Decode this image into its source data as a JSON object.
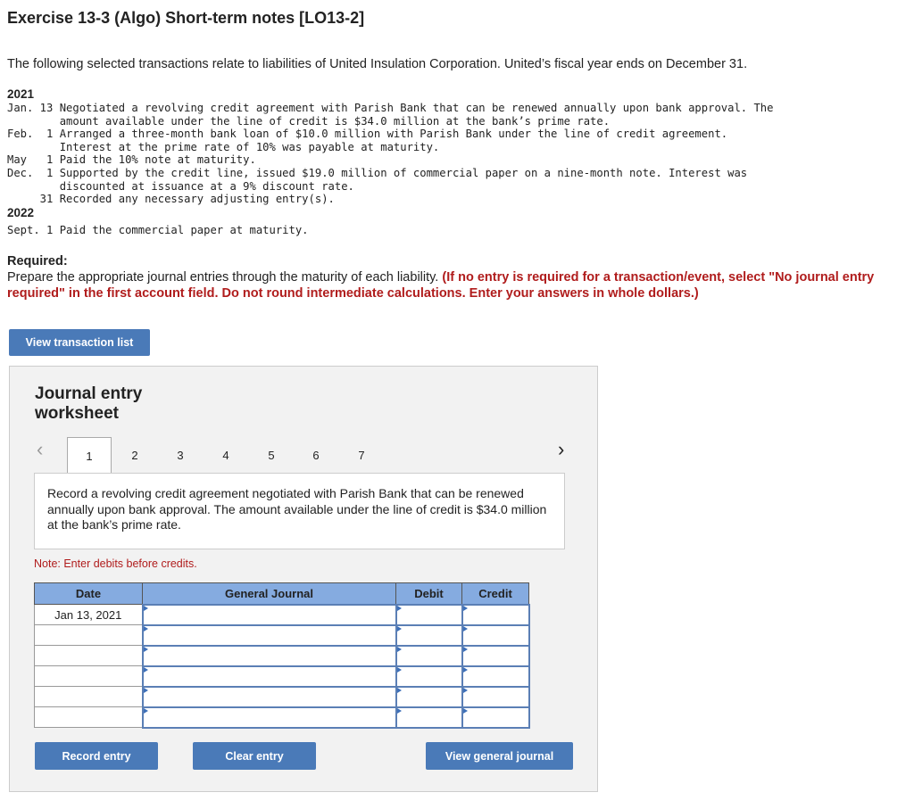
{
  "title": "Exercise 13-3 (Algo) Short-term notes [LO13-2]",
  "intro": "The following selected transactions relate to liabilities of United Insulation Corporation. United’s fiscal year ends on December 31.",
  "transactions": {
    "year1": "2021",
    "lines1": "Jan. 13 Negotiated a revolving credit agreement with Parish Bank that can be renewed annually upon bank approval. The\n        amount available under the line of credit is $34.0 million at the bank’s prime rate.\nFeb.  1 Arranged a three-month bank loan of $10.0 million with Parish Bank under the line of credit agreement.\n        Interest at the prime rate of 10% was payable at maturity.\nMay   1 Paid the 10% note at maturity.\nDec.  1 Supported by the credit line, issued $19.0 million of commercial paper on a nine-month note. Interest was\n        discounted at issuance at a 9% discount rate.\n     31 Recorded any necessary adjusting entry(s).",
    "year2": "2022",
    "lines2": "Sept. 1 Paid the commercial paper at maturity."
  },
  "required": {
    "label": "Required:",
    "text": "Prepare the appropriate journal entries through the maturity of each liability. ",
    "instruction": "(If no entry is required for a transaction/event, select \"No journal entry required\" in the first account field. Do not round intermediate calculations. Enter your answers in whole dollars.)"
  },
  "view_transaction_list": "View transaction list",
  "worksheet": {
    "title": "Journal entry worksheet",
    "tabs": [
      "1",
      "2",
      "3",
      "4",
      "5",
      "6",
      "7"
    ],
    "active_tab": "1",
    "description": "Record a revolving credit agreement negotiated with Parish Bank that can be renewed annually upon bank approval. The amount available under the line of credit is $34.0 million at the bank’s prime rate.",
    "note": "Note: Enter debits before credits.",
    "columns": [
      "Date",
      "General Journal",
      "Debit",
      "Credit"
    ],
    "rows": [
      {
        "date": "Jan 13, 2021"
      },
      {
        "date": ""
      },
      {
        "date": ""
      },
      {
        "date": ""
      },
      {
        "date": ""
      },
      {
        "date": ""
      }
    ],
    "record_entry": "Record entry",
    "clear_entry": "Clear entry",
    "view_general_journal": "View general journal"
  },
  "colors": {
    "button": "#4a7ab8",
    "header": "#85abe0",
    "red": "#b01c1c"
  }
}
